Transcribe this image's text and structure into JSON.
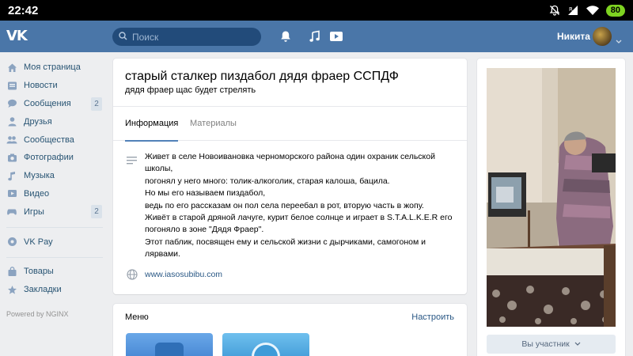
{
  "status_bar": {
    "time": "22:42",
    "battery": "80",
    "signal_label": "R",
    "icons": [
      "mute-bell-icon",
      "signal-icon",
      "wifi-icon",
      "battery-icon"
    ]
  },
  "header": {
    "logo": "VK",
    "search_placeholder": "Поиск",
    "username": "Никита",
    "icons": [
      "bell-icon",
      "music-note-icon",
      "video-play-icon"
    ],
    "brand_color": "#4a76a8"
  },
  "sidebar": {
    "items": [
      {
        "label": "Моя страница",
        "icon": "home-icon"
      },
      {
        "label": "Новости",
        "icon": "news-icon"
      },
      {
        "label": "Сообщения",
        "icon": "messages-icon",
        "count": "2"
      },
      {
        "label": "Друзья",
        "icon": "friends-icon"
      },
      {
        "label": "Сообщества",
        "icon": "communities-icon"
      },
      {
        "label": "Фотографии",
        "icon": "camera-icon"
      },
      {
        "label": "Музыка",
        "icon": "music-icon"
      },
      {
        "label": "Видео",
        "icon": "video-icon"
      },
      {
        "label": "Игры",
        "icon": "games-icon",
        "count": "2"
      }
    ],
    "vkpay": {
      "label": "VK Pay",
      "icon": "vkpay-icon"
    },
    "extra": [
      {
        "label": "Товары",
        "icon": "bag-icon"
      },
      {
        "label": "Закладки",
        "icon": "star-icon"
      }
    ],
    "powered_by": "Powered by NGINX"
  },
  "group": {
    "title": "старый сталкер пиздабол дядя фраер ССПДФ",
    "status": "дядя фраер щас будет стрелять",
    "tabs": [
      {
        "label": "Информация",
        "active": true
      },
      {
        "label": "Материалы",
        "active": false
      }
    ],
    "description": [
      "Живет в селе Новоивановка черноморского района один охраник сельской",
      "школы,",
      "погонял у него много: толик-алкоголик, старая калоша, бацила.",
      "Но мы его называем пиздабол,",
      "ведь по его рассказам он пол села переебал в рот, вторую часть в жопу.",
      "Живёт в старой дряной лачуге, курит белое солнце и играет в S.T.A.L.K.E.R его",
      "погоняло в зоне \"Дядя Фраер\".",
      "Этот паблик, посвящен ему и сельской жизни с дырчиками, самогоном и",
      "лярвами."
    ],
    "website": "www.iasosubibu.com"
  },
  "menu": {
    "title": "Меню",
    "settings_label": "Настроить"
  },
  "side": {
    "member_button": "Вы участник"
  }
}
